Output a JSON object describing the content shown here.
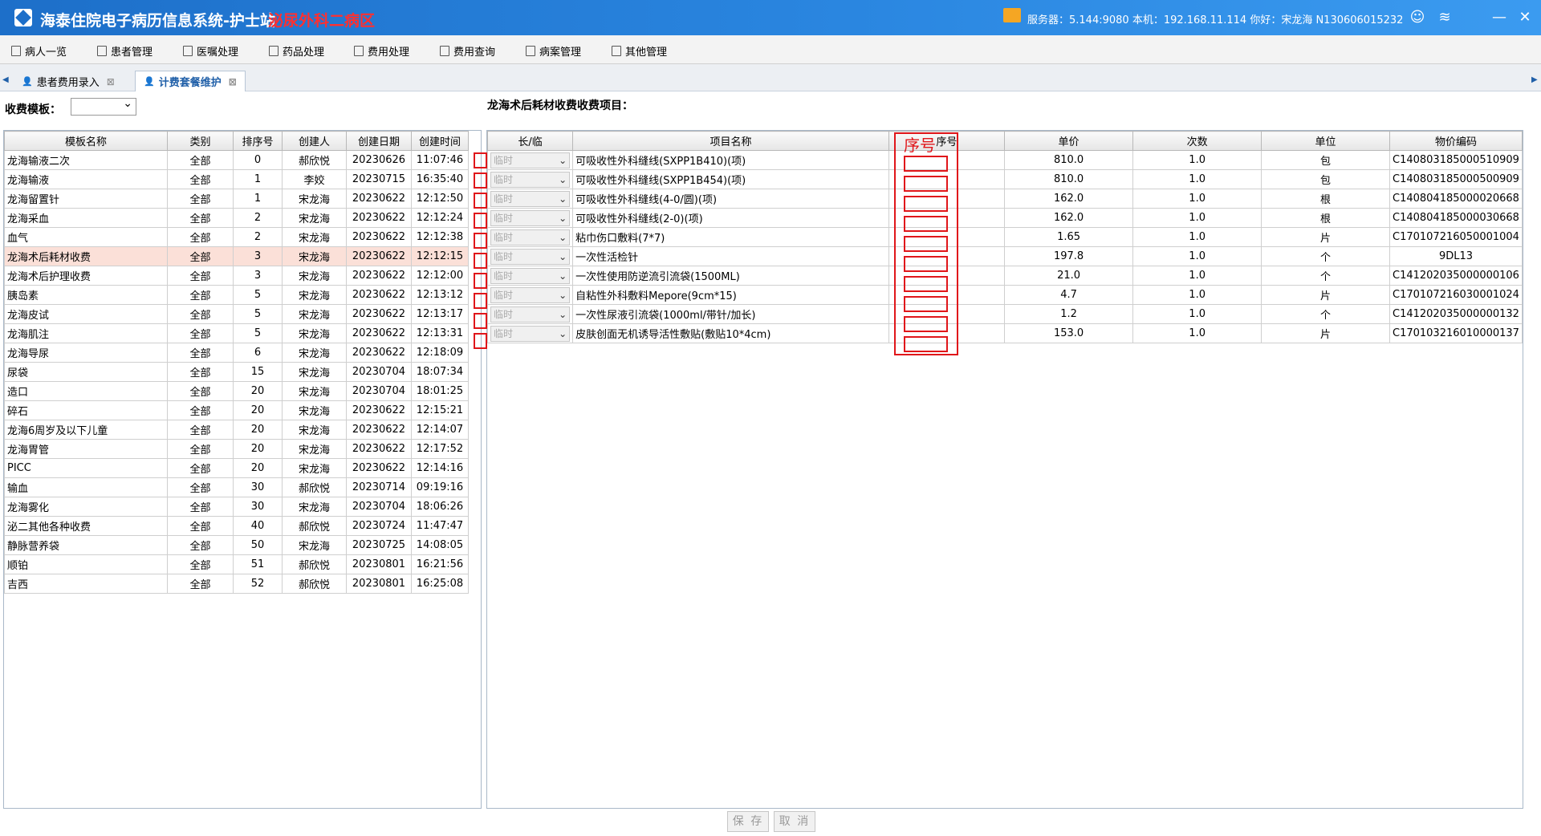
{
  "app": {
    "title": "海泰住院电子病历信息系统-护士站",
    "ward": "泌尿外科二病区",
    "server_info": "服务器：5.144:9080 本机：192.168.11.114 你好：宋龙海 N130606015232"
  },
  "menu": [
    {
      "label": "病人一览"
    },
    {
      "label": "患者管理"
    },
    {
      "label": "医嘱处理"
    },
    {
      "label": "药品处理"
    },
    {
      "label": "费用处理"
    },
    {
      "label": "费用查询"
    },
    {
      "label": "病案管理"
    },
    {
      "label": "其他管理"
    }
  ],
  "tabs": [
    {
      "label": "患者费用录入",
      "active": false
    },
    {
      "label": "计费套餐维护",
      "active": true
    }
  ],
  "filter": {
    "label": "收费模板：",
    "value": ""
  },
  "right_title": "龙海术后耗材收费收费项目：",
  "left_table": {
    "columns": [
      "模板名称",
      "类别",
      "排序号",
      "创建人",
      "创建日期",
      "创建时间"
    ],
    "rows": [
      [
        "龙海输液二次",
        "全部",
        "0",
        "郝欣悦",
        "20230626",
        "11:07:46"
      ],
      [
        "龙海输液",
        "全部",
        "1",
        "李姣",
        "20230715",
        "16:35:40"
      ],
      [
        "龙海留置针",
        "全部",
        "1",
        "宋龙海",
        "20230622",
        "12:12:50"
      ],
      [
        "龙海采血",
        "全部",
        "2",
        "宋龙海",
        "20230622",
        "12:12:24"
      ],
      [
        "血气",
        "全部",
        "2",
        "宋龙海",
        "20230622",
        "12:12:38"
      ],
      [
        "龙海术后耗材收费",
        "全部",
        "3",
        "宋龙海",
        "20230622",
        "12:12:15"
      ],
      [
        "龙海术后护理收费",
        "全部",
        "3",
        "宋龙海",
        "20230622",
        "12:12:00"
      ],
      [
        "胰岛素",
        "全部",
        "5",
        "宋龙海",
        "20230622",
        "12:13:12"
      ],
      [
        "龙海皮试",
        "全部",
        "5",
        "宋龙海",
        "20230622",
        "12:13:17"
      ],
      [
        "龙海肌注",
        "全部",
        "5",
        "宋龙海",
        "20230622",
        "12:13:31"
      ],
      [
        "龙海导尿",
        "全部",
        "6",
        "宋龙海",
        "20230622",
        "12:18:09"
      ],
      [
        "尿袋",
        "全部",
        "15",
        "宋龙海",
        "20230704",
        "18:07:34"
      ],
      [
        "造口",
        "全部",
        "20",
        "宋龙海",
        "20230704",
        "18:01:25"
      ],
      [
        "碎石",
        "全部",
        "20",
        "宋龙海",
        "20230622",
        "12:15:21"
      ],
      [
        "龙海6周岁及以下儿童",
        "全部",
        "20",
        "宋龙海",
        "20230622",
        "12:14:07"
      ],
      [
        "龙海胃管",
        "全部",
        "20",
        "宋龙海",
        "20230622",
        "12:17:52"
      ],
      [
        "PICC",
        "全部",
        "20",
        "宋龙海",
        "20230622",
        "12:14:16"
      ],
      [
        "输血",
        "全部",
        "30",
        "郝欣悦",
        "20230714",
        "09:19:16"
      ],
      [
        "龙海雾化",
        "全部",
        "30",
        "宋龙海",
        "20230704",
        "18:06:26"
      ],
      [
        "泌二其他各种收费",
        "全部",
        "40",
        "郝欣悦",
        "20230724",
        "11:47:47"
      ],
      [
        "静脉营养袋",
        "全部",
        "50",
        "宋龙海",
        "20230725",
        "14:08:05"
      ],
      [
        "顺铂",
        "全部",
        "51",
        "郝欣悦",
        "20230801",
        "16:21:56"
      ],
      [
        "吉西",
        "全部",
        "52",
        "郝欣悦",
        "20230801",
        "16:25:08"
      ]
    ],
    "selected_row": 5
  },
  "right_table": {
    "columns": [
      "长/临",
      "项目名称",
      "序号",
      "单价",
      "次数",
      "单位",
      "物价编码"
    ],
    "type_value": "临时",
    "rows": [
      [
        "可吸收性外科缝线(SXPP1B410)(项)",
        "810.0",
        "1.0",
        "包",
        "C140803185000510909"
      ],
      [
        "可吸收性外科缝线(SXPP1B454)(项)",
        "810.0",
        "1.0",
        "包",
        "C140803185000500909"
      ],
      [
        "可吸收性外科缝线(4-0/圆)(项)",
        "162.0",
        "1.0",
        "根",
        "C140804185000020668"
      ],
      [
        "可吸收性外科缝线(2-0)(项)",
        "162.0",
        "1.0",
        "根",
        "C140804185000030668"
      ],
      [
        "粘巾伤口敷料(7*7)",
        "1.65",
        "1.0",
        "片",
        "C170107216050001004"
      ],
      [
        "一次性活检针",
        "197.8",
        "1.0",
        "个",
        "9DL13"
      ],
      [
        "一次性使用防逆流引流袋(1500ML)",
        "21.0",
        "1.0",
        "个",
        "C141202035000000106"
      ],
      [
        "自粘性外科敷料Mepore(9cm*15)",
        "4.7",
        "1.0",
        "片",
        "C170107216030001024"
      ],
      [
        "一次性尿液引流袋(1000ml/带针/加长)",
        "1.2",
        "1.0",
        "个",
        "C141202035000000132"
      ],
      [
        "皮肤创面无机诱导活性敷贴(敷贴10*4cm)",
        "153.0",
        "1.0",
        "片",
        "C170103216010000137"
      ]
    ]
  },
  "annotation": {
    "label": "序号",
    "color": "#e0161a"
  },
  "buttons": {
    "save": "保 存",
    "cancel": "取 消"
  }
}
